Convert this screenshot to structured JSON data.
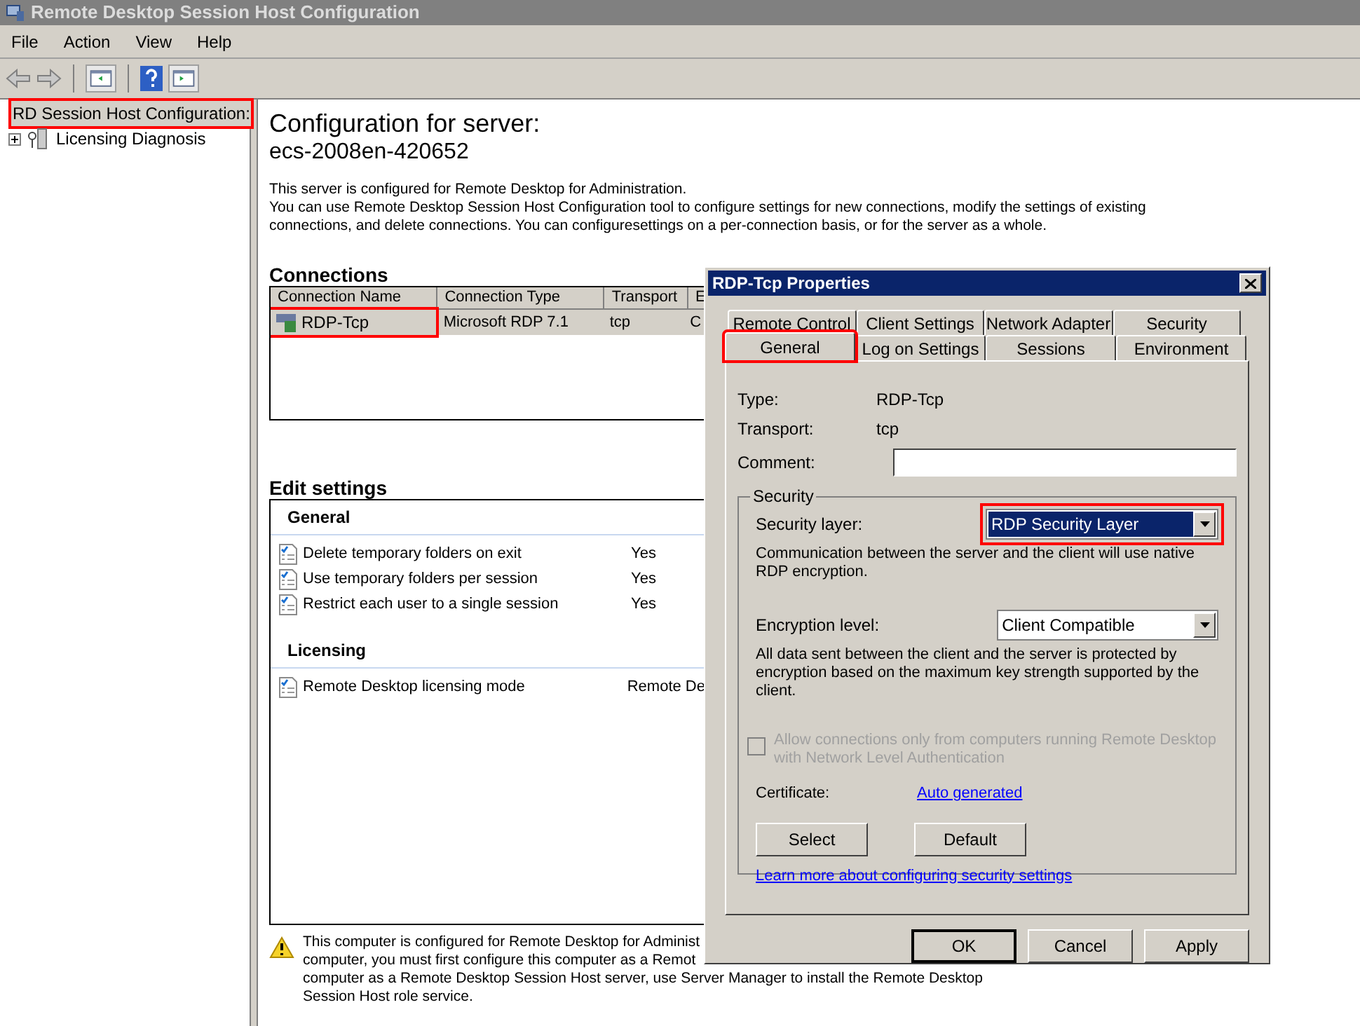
{
  "window": {
    "title": "Remote Desktop Session Host Configuration"
  },
  "menu": [
    "File",
    "Action",
    "View",
    "Help"
  ],
  "tree": [
    {
      "label": "RD Session Host Configuration:",
      "selected": true,
      "highlighted": true
    },
    {
      "label": "Licensing Diagnosis",
      "selected": false,
      "highlighted": false,
      "expanded": false
    }
  ],
  "main": {
    "heading": "Configuration for server:",
    "server": "ecs-2008en-420652",
    "intro": [
      "This server is configured for Remote Desktop for Administration.",
      "You can use Remote Desktop Session Host Configuration tool to configure settings for new connections, modify the settings of existing connections, and delete connections. You can configuresettings on a per-connection basis, or for the server as a whole."
    ],
    "connections": {
      "title": "Connections",
      "columns": [
        "Connection Name",
        "Connection Type",
        "Transport",
        "E"
      ],
      "rows": [
        {
          "cells": [
            "RDP-Tcp",
            "Microsoft RDP 7.1",
            "tcp",
            "C"
          ],
          "selected": true,
          "highlighted": true
        }
      ]
    },
    "edit_settings": {
      "title": "Edit settings",
      "groups": [
        {
          "title": "General",
          "items": [
            {
              "label": "Delete temporary folders on exit",
              "value": "Yes"
            },
            {
              "label": "Use temporary folders per session",
              "value": "Yes"
            },
            {
              "label": "Restrict each user to a single session",
              "value": "Yes"
            }
          ]
        },
        {
          "title": "Licensing",
          "items": [
            {
              "label": "Remote Desktop licensing mode",
              "value": "Remote De"
            }
          ]
        }
      ]
    },
    "warning": [
      "This computer is configured for Remote Desktop for Administ",
      "computer, you must first configure this computer as a Remot",
      "computer as a Remote Desktop Session Host server, use Server Manager to install the Remote Desktop",
      "Session Host role service."
    ]
  },
  "dialog": {
    "title": "RDP-Tcp Properties",
    "tab_rows": [
      [
        {
          "label": "Remote Control",
          "selected": false,
          "highlighted": false
        },
        {
          "label": "Client Settings",
          "selected": false,
          "highlighted": false
        },
        {
          "label": "Network Adapter",
          "selected": false,
          "highlighted": false
        },
        {
          "label": "Security",
          "selected": false,
          "highlighted": false
        }
      ],
      [
        {
          "label": "General",
          "selected": true,
          "highlighted": true
        },
        {
          "label": "Log on Settings",
          "selected": false,
          "highlighted": false
        },
        {
          "label": "Sessions",
          "selected": false,
          "highlighted": false
        },
        {
          "label": "Environment",
          "selected": false,
          "highlighted": false
        }
      ]
    ],
    "type_label": "Type:",
    "type_value": "RDP-Tcp",
    "transport_label": "Transport:",
    "transport_value": "tcp",
    "comment_label": "Comment:",
    "security": {
      "title": "Security",
      "layer_label": "Security layer:",
      "layer_value": "RDP Security Layer",
      "layer_focused": true,
      "layer_highlighted": true,
      "layer_description": "Communication between the server and the client will use native RDP encryption.",
      "encryption_label": "Encryption level:",
      "encryption_value": "Client Compatible",
      "encryption_description": "All data sent between the client and the server is protected by encryption based on the maximum key strength supported by the client.",
      "nla": {
        "label": "Allow connections only from computers running Remote Desktop with Network Level Authentication",
        "checked": false,
        "disabled": true
      },
      "certificate_label": "Certificate:",
      "certificate_link": "Auto generated",
      "buttons": [
        "Select",
        "Default"
      ],
      "learn_link": "Learn more about configuring security settings"
    },
    "buttons": [
      {
        "label": "OK",
        "default": true
      },
      {
        "label": "Cancel",
        "default": false
      },
      {
        "label": "Apply",
        "default": false
      }
    ]
  }
}
